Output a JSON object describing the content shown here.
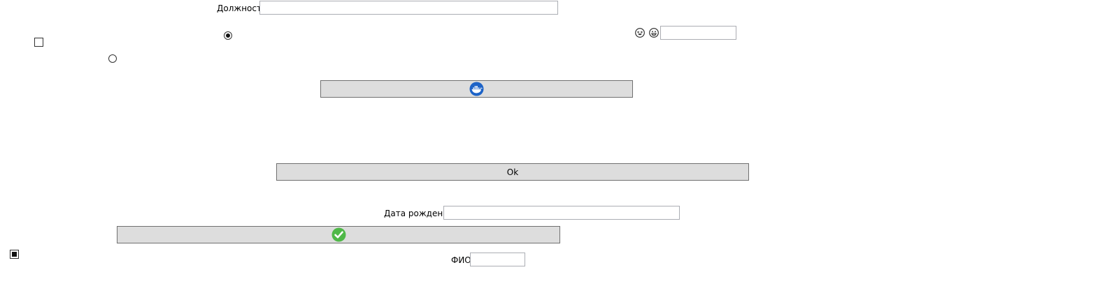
{
  "form": {
    "position_label": "Должность",
    "position_value": "",
    "birthdate_label": "Дата рождения",
    "birthdate_value": "",
    "fullname_label": "ФИО",
    "fullname_value": "",
    "emoji_field_value": "",
    "ok_button_label": "Ok"
  },
  "controls": {
    "checkbox_top_checked": false,
    "checkbox_bottom_checked": true,
    "radio_top_checked": true,
    "radio_bottom_checked": false
  },
  "icons": {
    "emoji_1": "laughing-face-icon",
    "emoji_2": "grinning-face-icon",
    "button_1_icon": "docker-whale-icon",
    "button_2_icon": "green-checkmark-icon"
  },
  "colors": {
    "docker_blue": "#1d63c7",
    "check_green": "#4fb848",
    "button_bg": "#dddddd"
  }
}
